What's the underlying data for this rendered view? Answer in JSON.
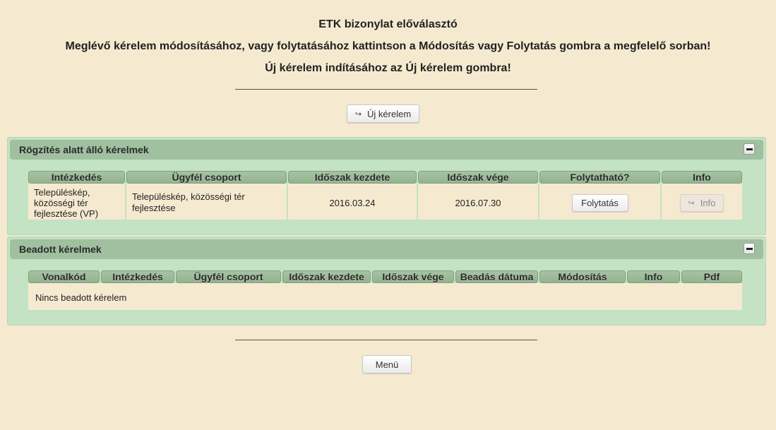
{
  "header": {
    "title": "ETK bizonylat előválasztó",
    "instruction_1": "Meglévő kérelem módosításához, vagy folytatásához kattintson a Módosítás vagy Folytatás gombra a megfelelő sorban!",
    "instruction_2": "Új kérelem indításához az Új kérelem gombra!"
  },
  "new_request_button": {
    "label": "Új kérelem",
    "icon": "arrow-return-right-icon"
  },
  "in_progress_panel": {
    "title": "Rögzítés alatt álló kérelmek",
    "collapse_icon": "minus-icon",
    "columns": [
      "Intézkedés",
      "Ügyfél csoport",
      "Időszak kezdete",
      "Időszak vége",
      "Folytatható?",
      "Info"
    ],
    "rows": [
      {
        "intezkedes": "Településkép, közösségi tér fejlesztése (VP)",
        "ugyfel_csoport": "Településkép, közösségi tér fejlesztése",
        "kezdete": "2016.03.24",
        "vege": "2016.07.30",
        "continue_label": "Folytatás",
        "info_label": "Info"
      }
    ]
  },
  "submitted_panel": {
    "title": "Beadott kérelmek",
    "collapse_icon": "minus-icon",
    "columns": [
      "Vonalkód",
      "Intézkedés",
      "Ügyfél csoport",
      "Időszak kezdete",
      "Időszak vége",
      "Beadás dátuma",
      "Módosítás",
      "Info",
      "Pdf"
    ],
    "empty_message": "Nincs beadott kérelem"
  },
  "menu_button": {
    "label": "Menü"
  }
}
